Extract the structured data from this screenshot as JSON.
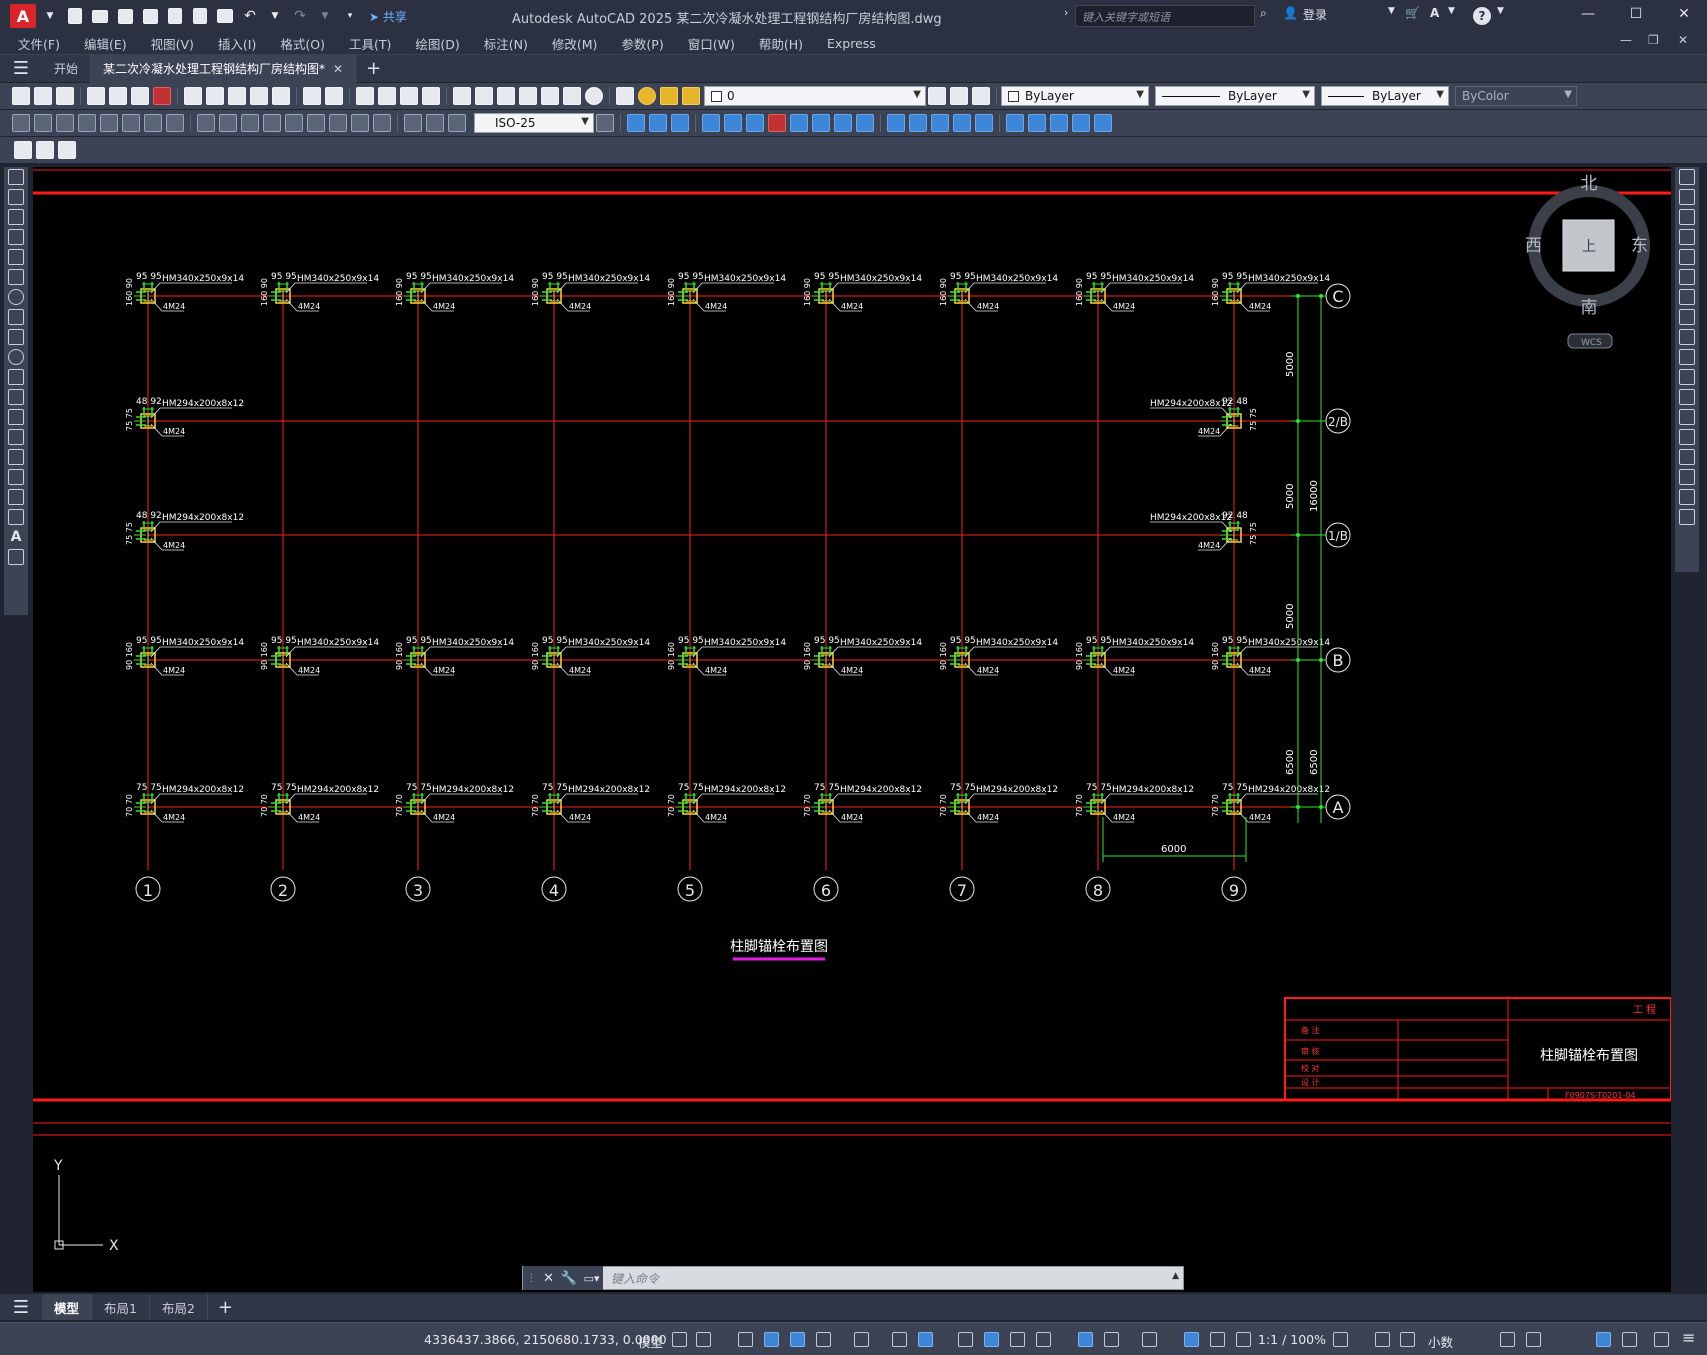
{
  "titlebar": {
    "logo": "A",
    "share": "共享",
    "title": "Autodesk AutoCAD 2025    某二次冷凝水处理工程钢结构厂房结构图.dwg",
    "search_placeholder": "键入关键字或短语",
    "login": "登录"
  },
  "menu": [
    "文件(F)",
    "编辑(E)",
    "视图(V)",
    "插入(I)",
    "格式(O)",
    "工具(T)",
    "绘图(D)",
    "标注(N)",
    "修改(M)",
    "参数(P)",
    "窗口(W)",
    "帮助(H)",
    "Express"
  ],
  "tabs": {
    "start": "开始",
    "active_doc": "某二次冷凝水处理工程钢结构厂房结构图*"
  },
  "properties": {
    "layer": "0",
    "color": "ByLayer",
    "linetype": "ByLayer",
    "lineweight": "ByLayer",
    "plotstyle": "ByColor",
    "dimstyle": "ISO-25"
  },
  "viewcube": {
    "north": "北",
    "south": "南",
    "east": "东",
    "west": "西",
    "face": "上",
    "wcs": "WCS"
  },
  "drawing": {
    "top_col_label": "HM340x250x9x14",
    "top_dims_mid": "95 95",
    "top_side_dim": "160 90",
    "bolt_label": "4M24",
    "mid_col_label": "HM294x200x8x12",
    "mid_dim_left": "48 92",
    "mid_dim_right": "92 48",
    "mid_side_dim": "75 75",
    "b_side_dim": "90 160",
    "a_col_label": "HM294x200x8x12",
    "a_dims_mid": "75 75",
    "a_side_dim": "70 70",
    "col_axes": [
      "1",
      "2",
      "3",
      "4",
      "5",
      "6",
      "7",
      "8",
      "9"
    ],
    "row_axes": [
      "C",
      "2/B",
      "1/B",
      "B",
      "A"
    ],
    "dim_5000": "5000",
    "dim_16000": "16000",
    "dim_6500": "6500",
    "dim_6000": "6000",
    "drawing_title": "柱脚锚栓布置图",
    "titleblock": {
      "project": "工 程",
      "sheet_title": "柱脚锚栓布置图",
      "drawing_no": "F0907S-T0201-04",
      "row_labels": [
        "设 计",
        "校 对",
        "审 核",
        "制 图",
        "备 注"
      ]
    },
    "axis_y": "Y",
    "axis_x": "X"
  },
  "command": {
    "placeholder": "键入命令"
  },
  "layouts": [
    "模型",
    "布局1",
    "布局2"
  ],
  "status": {
    "coords": "4336437.3866, 2150680.1733, 0.0000",
    "space": "模型",
    "scale": "1:1 / 100%",
    "units": "小数"
  }
}
